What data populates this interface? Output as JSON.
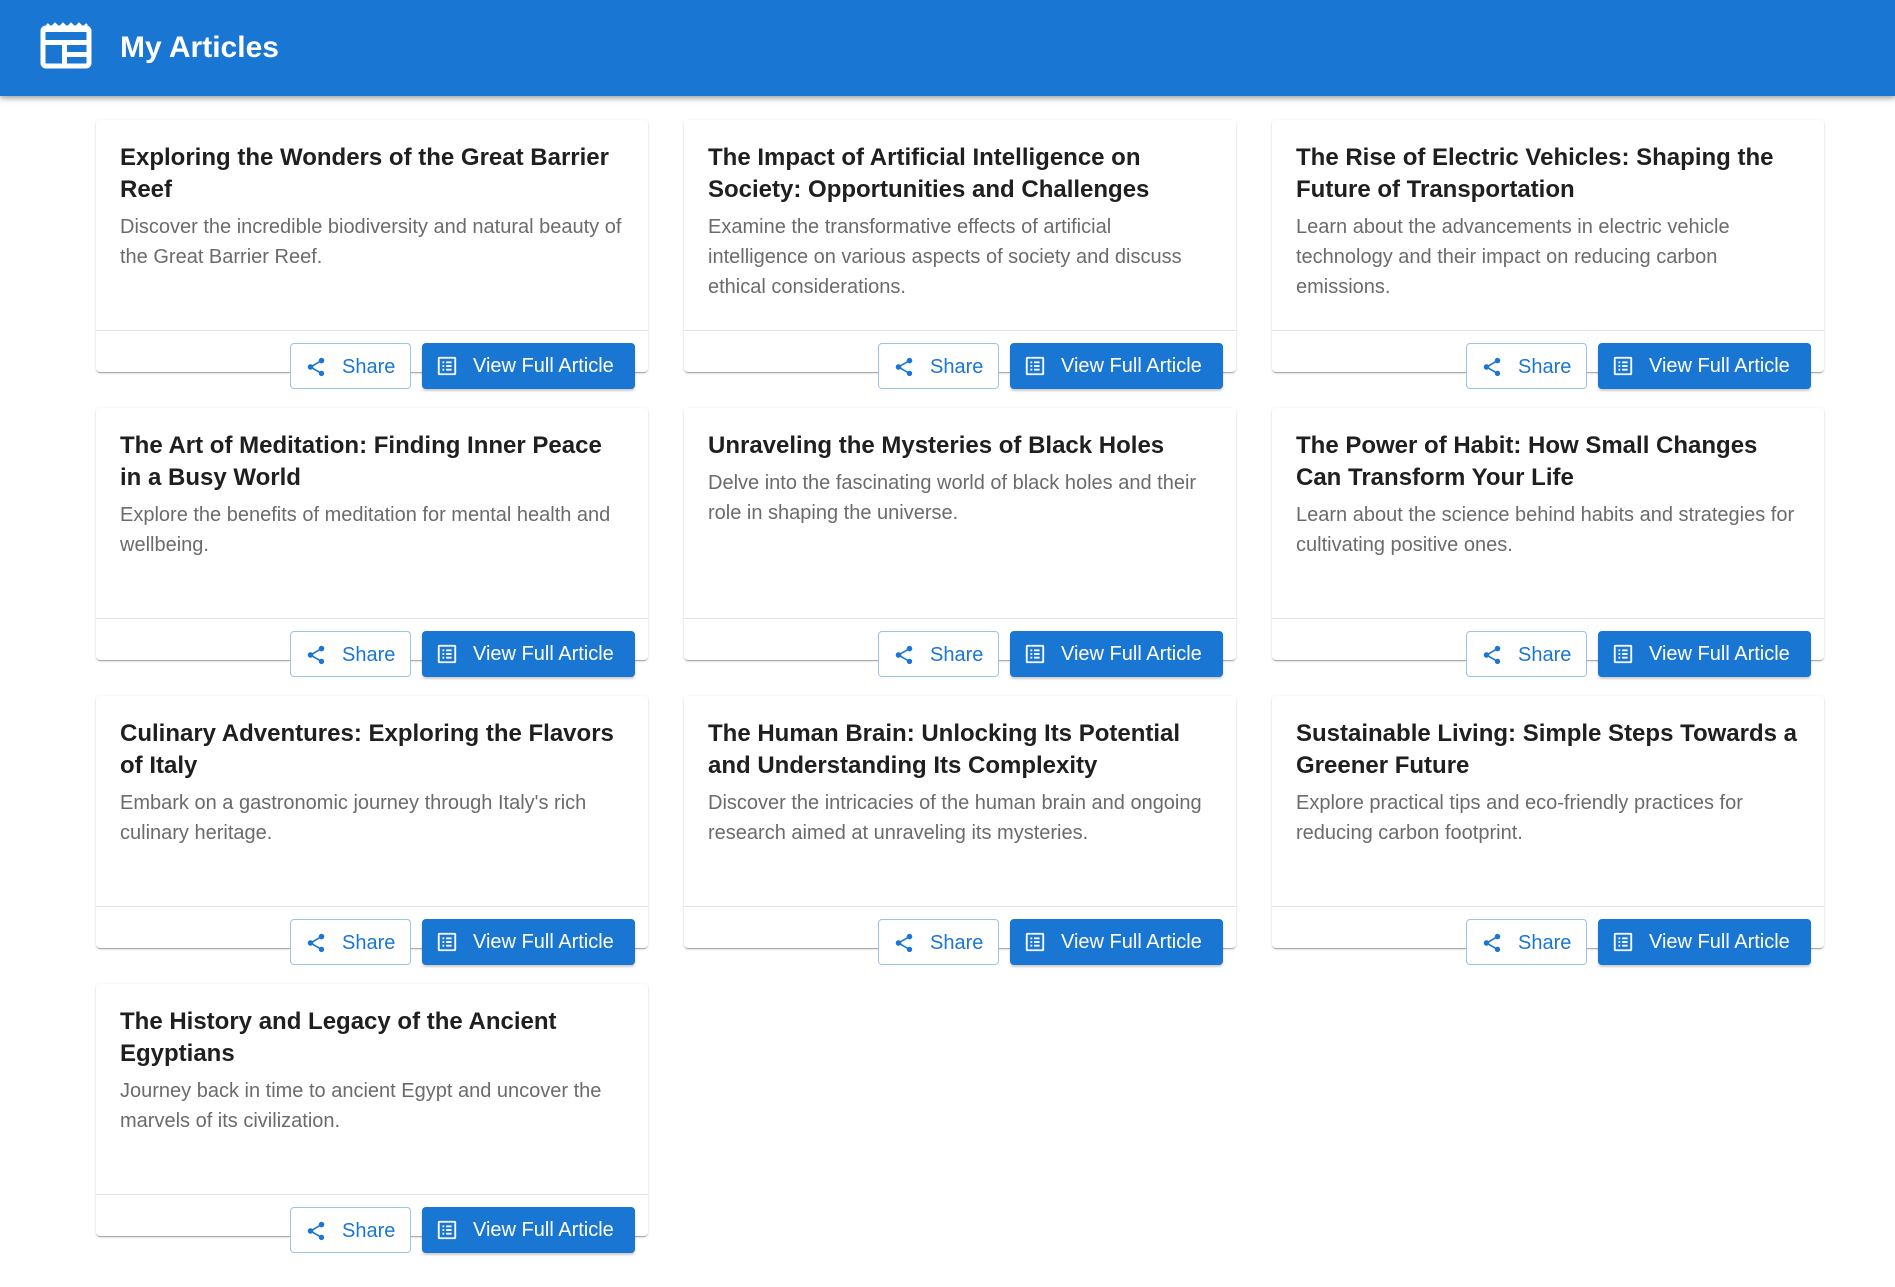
{
  "header": {
    "title": "My Articles",
    "icon": "newspaper-icon",
    "bg_color": "#1976d2"
  },
  "buttons": {
    "share_label": "Share",
    "view_label": "View Full Article",
    "share_icon": "share-icon",
    "view_icon": "article-icon"
  },
  "articles": [
    {
      "title": "Exploring the Wonders of the Great Barrier Reef",
      "description": "Discover the incredible biodiversity and natural beauty of the Great Barrier Reef."
    },
    {
      "title": "The Impact of Artificial Intelligence on Society: Opportunities and Challenges",
      "description": "Examine the transformative effects of artificial intelligence on various aspects of society and discuss ethical considerations."
    },
    {
      "title": "The Rise of Electric Vehicles: Shaping the Future of Transportation",
      "description": "Learn about the advancements in electric vehicle technology and their impact on reducing carbon emissions."
    },
    {
      "title": "The Art of Meditation: Finding Inner Peace in a Busy World",
      "description": "Explore the benefits of meditation for mental health and wellbeing."
    },
    {
      "title": "Unraveling the Mysteries of Black Holes",
      "description": "Delve into the fascinating world of black holes and their role in shaping the universe."
    },
    {
      "title": "The Power of Habit: How Small Changes Can Transform Your Life",
      "description": "Learn about the science behind habits and strategies for cultivating positive ones."
    },
    {
      "title": "Culinary Adventures: Exploring the Flavors of Italy",
      "description": "Embark on a gastronomic journey through Italy's rich culinary heritage."
    },
    {
      "title": "The Human Brain: Unlocking Its Potential and Understanding Its Complexity",
      "description": "Discover the intricacies of the human brain and ongoing research aimed at unraveling its mysteries."
    },
    {
      "title": "Sustainable Living: Simple Steps Towards a Greener Future",
      "description": "Explore practical tips and eco-friendly practices for reducing carbon footprint."
    },
    {
      "title": "The History and Legacy of the Ancient Egyptians",
      "description": "Journey back in time to ancient Egypt and uncover the marvels of its civilization."
    }
  ]
}
